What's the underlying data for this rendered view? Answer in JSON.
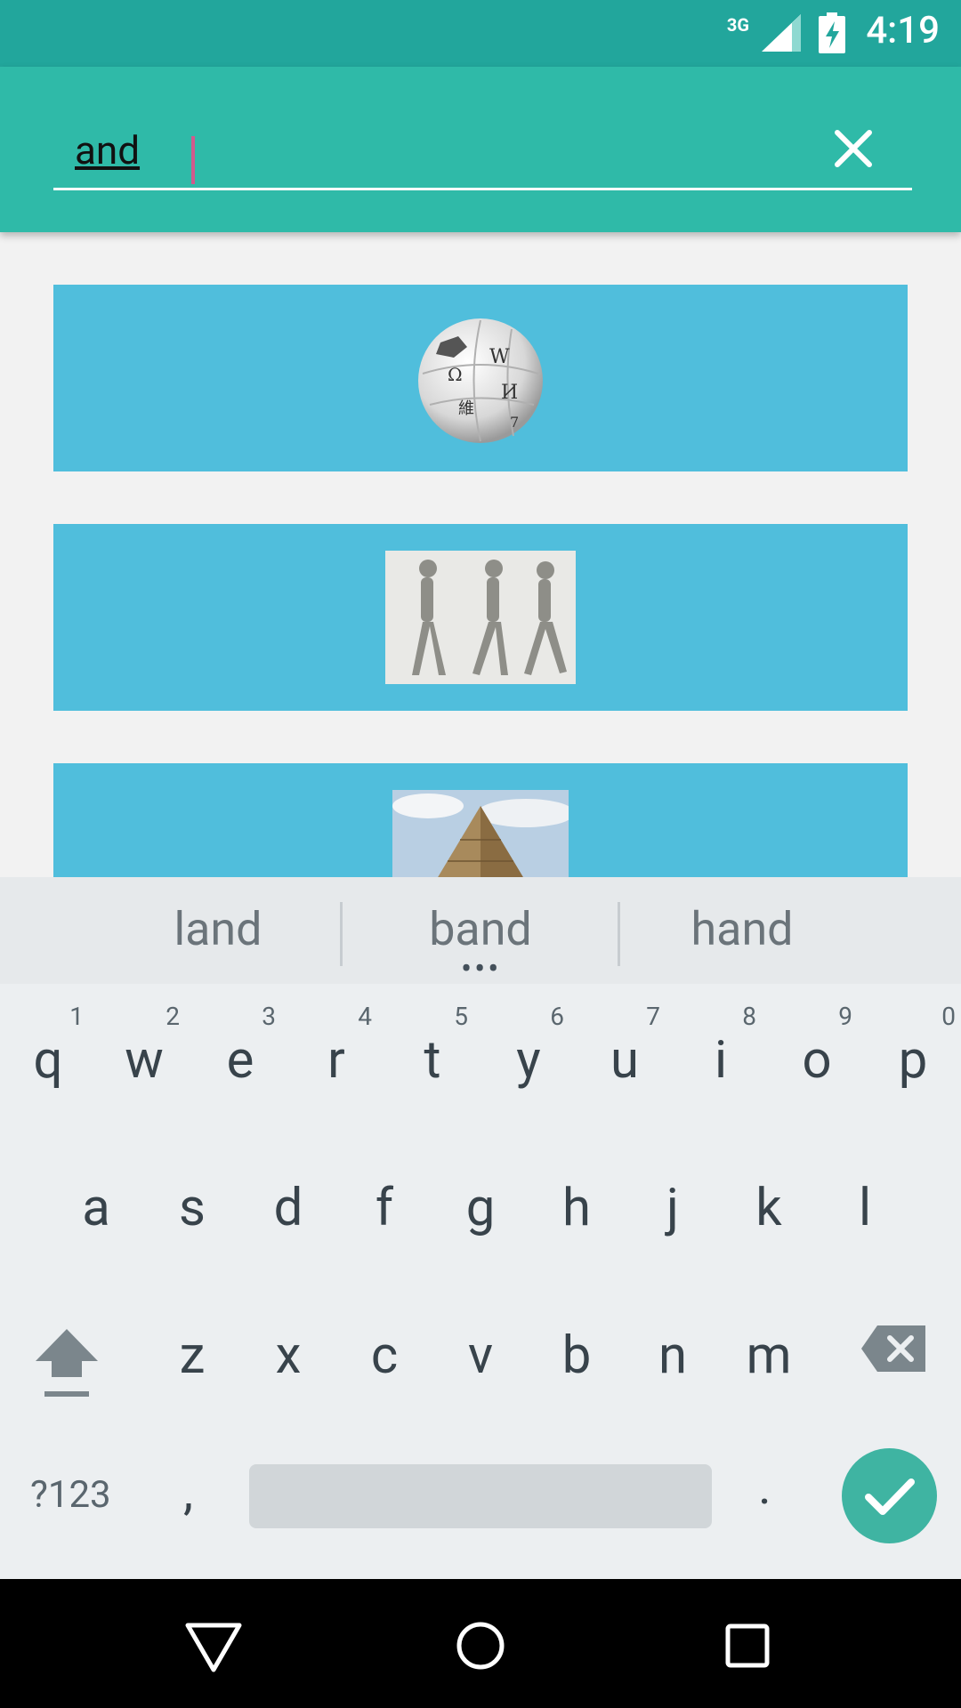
{
  "status_bar": {
    "network": "3G",
    "time": "4:19"
  },
  "search": {
    "query": "and"
  },
  "suggestions": [
    "land",
    "band",
    "hand"
  ],
  "keyboard": {
    "row1": [
      {
        "key": "q",
        "hint": "1"
      },
      {
        "key": "w",
        "hint": "2"
      },
      {
        "key": "e",
        "hint": "3"
      },
      {
        "key": "r",
        "hint": "4"
      },
      {
        "key": "t",
        "hint": "5"
      },
      {
        "key": "y",
        "hint": "6"
      },
      {
        "key": "u",
        "hint": "7"
      },
      {
        "key": "i",
        "hint": "8"
      },
      {
        "key": "o",
        "hint": "9"
      },
      {
        "key": "p",
        "hint": "0"
      }
    ],
    "row2": [
      "a",
      "s",
      "d",
      "f",
      "g",
      "h",
      "j",
      "k",
      "l"
    ],
    "row3": [
      "z",
      "x",
      "c",
      "v",
      "b",
      "n",
      "m"
    ],
    "symbols_label": "?123",
    "comma": ",",
    "period": "."
  },
  "colors": {
    "status_bar": "#22a69c",
    "app_bar": "#2fbaa8",
    "card": "#50bedc",
    "accent_done": "#3fb4a2",
    "caret": "#d05a8c"
  }
}
